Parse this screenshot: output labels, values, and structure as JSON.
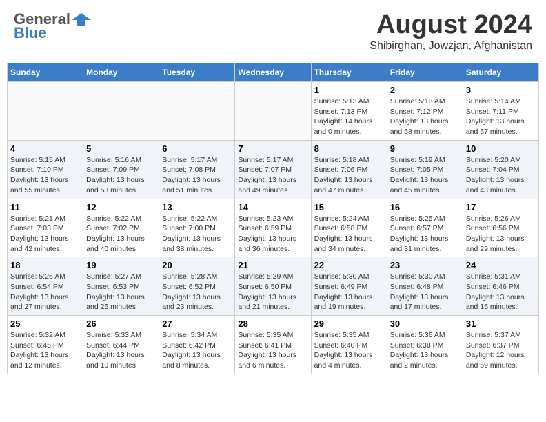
{
  "header": {
    "logo_general": "General",
    "logo_blue": "Blue",
    "main_title": "August 2024",
    "subtitle": "Shibirghan, Jowzjan, Afghanistan"
  },
  "calendar": {
    "days_of_week": [
      "Sunday",
      "Monday",
      "Tuesday",
      "Wednesday",
      "Thursday",
      "Friday",
      "Saturday"
    ],
    "weeks": [
      [
        {
          "day": "",
          "info": ""
        },
        {
          "day": "",
          "info": ""
        },
        {
          "day": "",
          "info": ""
        },
        {
          "day": "",
          "info": ""
        },
        {
          "day": "1",
          "info": "Sunrise: 5:13 AM\nSunset: 7:13 PM\nDaylight: 14 hours\nand 0 minutes."
        },
        {
          "day": "2",
          "info": "Sunrise: 5:13 AM\nSunset: 7:12 PM\nDaylight: 13 hours\nand 58 minutes."
        },
        {
          "day": "3",
          "info": "Sunrise: 5:14 AM\nSunset: 7:11 PM\nDaylight: 13 hours\nand 57 minutes."
        }
      ],
      [
        {
          "day": "4",
          "info": "Sunrise: 5:15 AM\nSunset: 7:10 PM\nDaylight: 13 hours\nand 55 minutes."
        },
        {
          "day": "5",
          "info": "Sunrise: 5:16 AM\nSunset: 7:09 PM\nDaylight: 13 hours\nand 53 minutes."
        },
        {
          "day": "6",
          "info": "Sunrise: 5:17 AM\nSunset: 7:08 PM\nDaylight: 13 hours\nand 51 minutes."
        },
        {
          "day": "7",
          "info": "Sunrise: 5:17 AM\nSunset: 7:07 PM\nDaylight: 13 hours\nand 49 minutes."
        },
        {
          "day": "8",
          "info": "Sunrise: 5:18 AM\nSunset: 7:06 PM\nDaylight: 13 hours\nand 47 minutes."
        },
        {
          "day": "9",
          "info": "Sunrise: 5:19 AM\nSunset: 7:05 PM\nDaylight: 13 hours\nand 45 minutes."
        },
        {
          "day": "10",
          "info": "Sunrise: 5:20 AM\nSunset: 7:04 PM\nDaylight: 13 hours\nand 43 minutes."
        }
      ],
      [
        {
          "day": "11",
          "info": "Sunrise: 5:21 AM\nSunset: 7:03 PM\nDaylight: 13 hours\nand 42 minutes."
        },
        {
          "day": "12",
          "info": "Sunrise: 5:22 AM\nSunset: 7:02 PM\nDaylight: 13 hours\nand 40 minutes."
        },
        {
          "day": "13",
          "info": "Sunrise: 5:22 AM\nSunset: 7:00 PM\nDaylight: 13 hours\nand 38 minutes."
        },
        {
          "day": "14",
          "info": "Sunrise: 5:23 AM\nSunset: 6:59 PM\nDaylight: 13 hours\nand 36 minutes."
        },
        {
          "day": "15",
          "info": "Sunrise: 5:24 AM\nSunset: 6:58 PM\nDaylight: 13 hours\nand 34 minutes."
        },
        {
          "day": "16",
          "info": "Sunrise: 5:25 AM\nSunset: 6:57 PM\nDaylight: 13 hours\nand 31 minutes."
        },
        {
          "day": "17",
          "info": "Sunrise: 5:26 AM\nSunset: 6:56 PM\nDaylight: 13 hours\nand 29 minutes."
        }
      ],
      [
        {
          "day": "18",
          "info": "Sunrise: 5:26 AM\nSunset: 6:54 PM\nDaylight: 13 hours\nand 27 minutes."
        },
        {
          "day": "19",
          "info": "Sunrise: 5:27 AM\nSunset: 6:53 PM\nDaylight: 13 hours\nand 25 minutes."
        },
        {
          "day": "20",
          "info": "Sunrise: 5:28 AM\nSunset: 6:52 PM\nDaylight: 13 hours\nand 23 minutes."
        },
        {
          "day": "21",
          "info": "Sunrise: 5:29 AM\nSunset: 6:50 PM\nDaylight: 13 hours\nand 21 minutes."
        },
        {
          "day": "22",
          "info": "Sunrise: 5:30 AM\nSunset: 6:49 PM\nDaylight: 13 hours\nand 19 minutes."
        },
        {
          "day": "23",
          "info": "Sunrise: 5:30 AM\nSunset: 6:48 PM\nDaylight: 13 hours\nand 17 minutes."
        },
        {
          "day": "24",
          "info": "Sunrise: 5:31 AM\nSunset: 6:46 PM\nDaylight: 13 hours\nand 15 minutes."
        }
      ],
      [
        {
          "day": "25",
          "info": "Sunrise: 5:32 AM\nSunset: 6:45 PM\nDaylight: 13 hours\nand 12 minutes."
        },
        {
          "day": "26",
          "info": "Sunrise: 5:33 AM\nSunset: 6:44 PM\nDaylight: 13 hours\nand 10 minutes."
        },
        {
          "day": "27",
          "info": "Sunrise: 5:34 AM\nSunset: 6:42 PM\nDaylight: 13 hours\nand 8 minutes."
        },
        {
          "day": "28",
          "info": "Sunrise: 5:35 AM\nSunset: 6:41 PM\nDaylight: 13 hours\nand 6 minutes."
        },
        {
          "day": "29",
          "info": "Sunrise: 5:35 AM\nSunset: 6:40 PM\nDaylight: 13 hours\nand 4 minutes."
        },
        {
          "day": "30",
          "info": "Sunrise: 5:36 AM\nSunset: 6:38 PM\nDaylight: 13 hours\nand 2 minutes."
        },
        {
          "day": "31",
          "info": "Sunrise: 5:37 AM\nSunset: 6:37 PM\nDaylight: 12 hours\nand 59 minutes."
        }
      ]
    ]
  }
}
